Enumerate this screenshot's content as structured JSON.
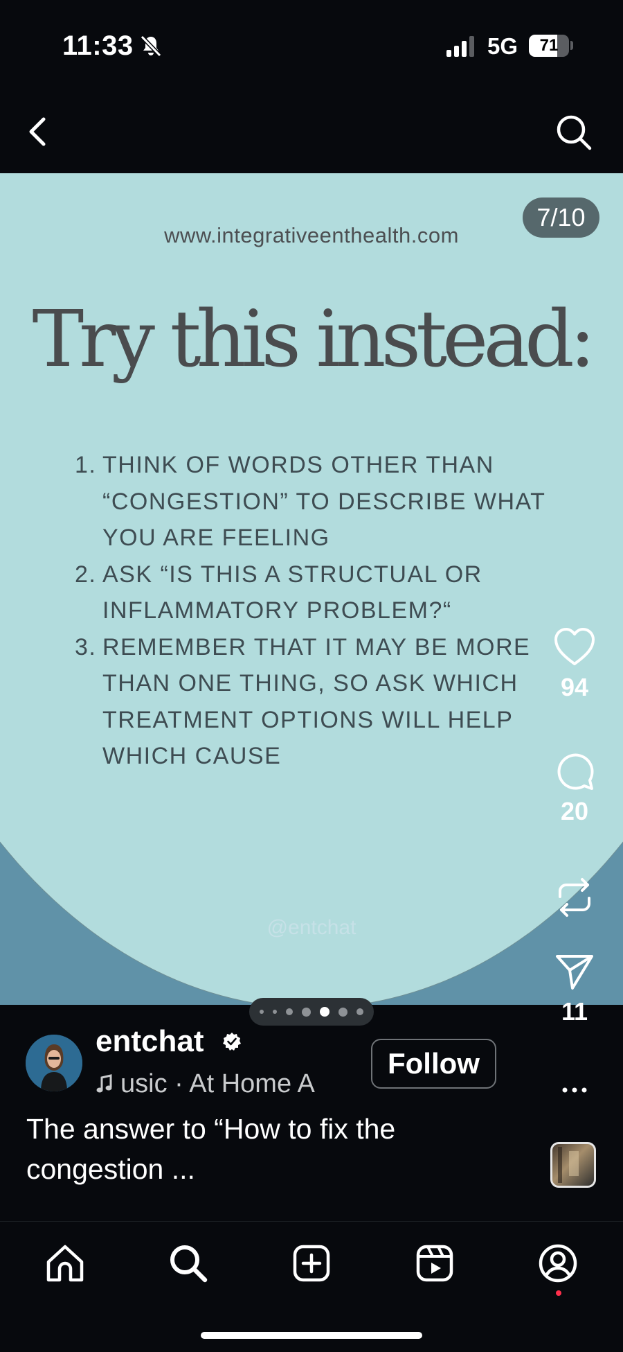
{
  "status_bar": {
    "time": "11:33",
    "network": "5G",
    "battery": "71",
    "battery_level": 0.71
  },
  "post": {
    "slide_counter": "7/10",
    "url": "www.integrativeenthealth.com",
    "headline": "Try this instead:",
    "tips": [
      {
        "num": "1.",
        "text": "THINK OF WORDS OTHER THAN “CONGESTION” TO DESCRIBE WHAT YOU ARE FEELING"
      },
      {
        "num": "2.",
        "text": "ASK “IS THIS A STRUCTUAL OR INFLAMMATORY PROBLEM?“"
      },
      {
        "num": "3.",
        "text": "REMEMBER THAT IT MAY BE MORE THAN ONE THING, SO ASK WHICH TREATMENT OPTIONS WILL HELP WHICH CAUSE"
      }
    ],
    "handle": "@entchat",
    "colors": {
      "bubble": "#b2dcdd",
      "background": "#6092a8",
      "text": "#4a4c4e"
    }
  },
  "carousel": {
    "total_dots": 7,
    "active_index": 4
  },
  "actions": {
    "likes": "94",
    "comments": "20",
    "shares": "11"
  },
  "author": {
    "name": "entchat",
    "music": "usic · At Home   A",
    "follow_label": "Follow"
  },
  "caption": "The answer to “How to fix the congestion ...",
  "icons": [
    "back-icon",
    "search-icon",
    "heart-icon",
    "comment-icon",
    "repost-icon",
    "send-icon",
    "more-icon",
    "home-icon",
    "create-icon",
    "reels-icon",
    "profile-icon",
    "verified-icon",
    "music-icon",
    "bell-slash-icon"
  ]
}
